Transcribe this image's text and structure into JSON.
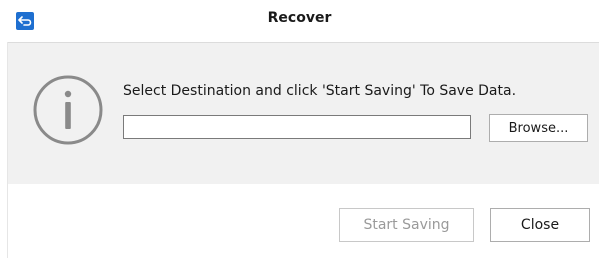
{
  "window": {
    "title": "Recover",
    "app_icon": "return-arrow-icon",
    "accent_color": "#1e6fd0"
  },
  "body": {
    "info_icon": "info-icon",
    "message": "Select Destination and click 'Start Saving' To Save Data.",
    "destination_input": {
      "value": "",
      "placeholder": ""
    },
    "browse_label": "Browse..."
  },
  "footer": {
    "start_saving_label": "Start Saving",
    "start_saving_enabled": false,
    "close_label": "Close"
  }
}
